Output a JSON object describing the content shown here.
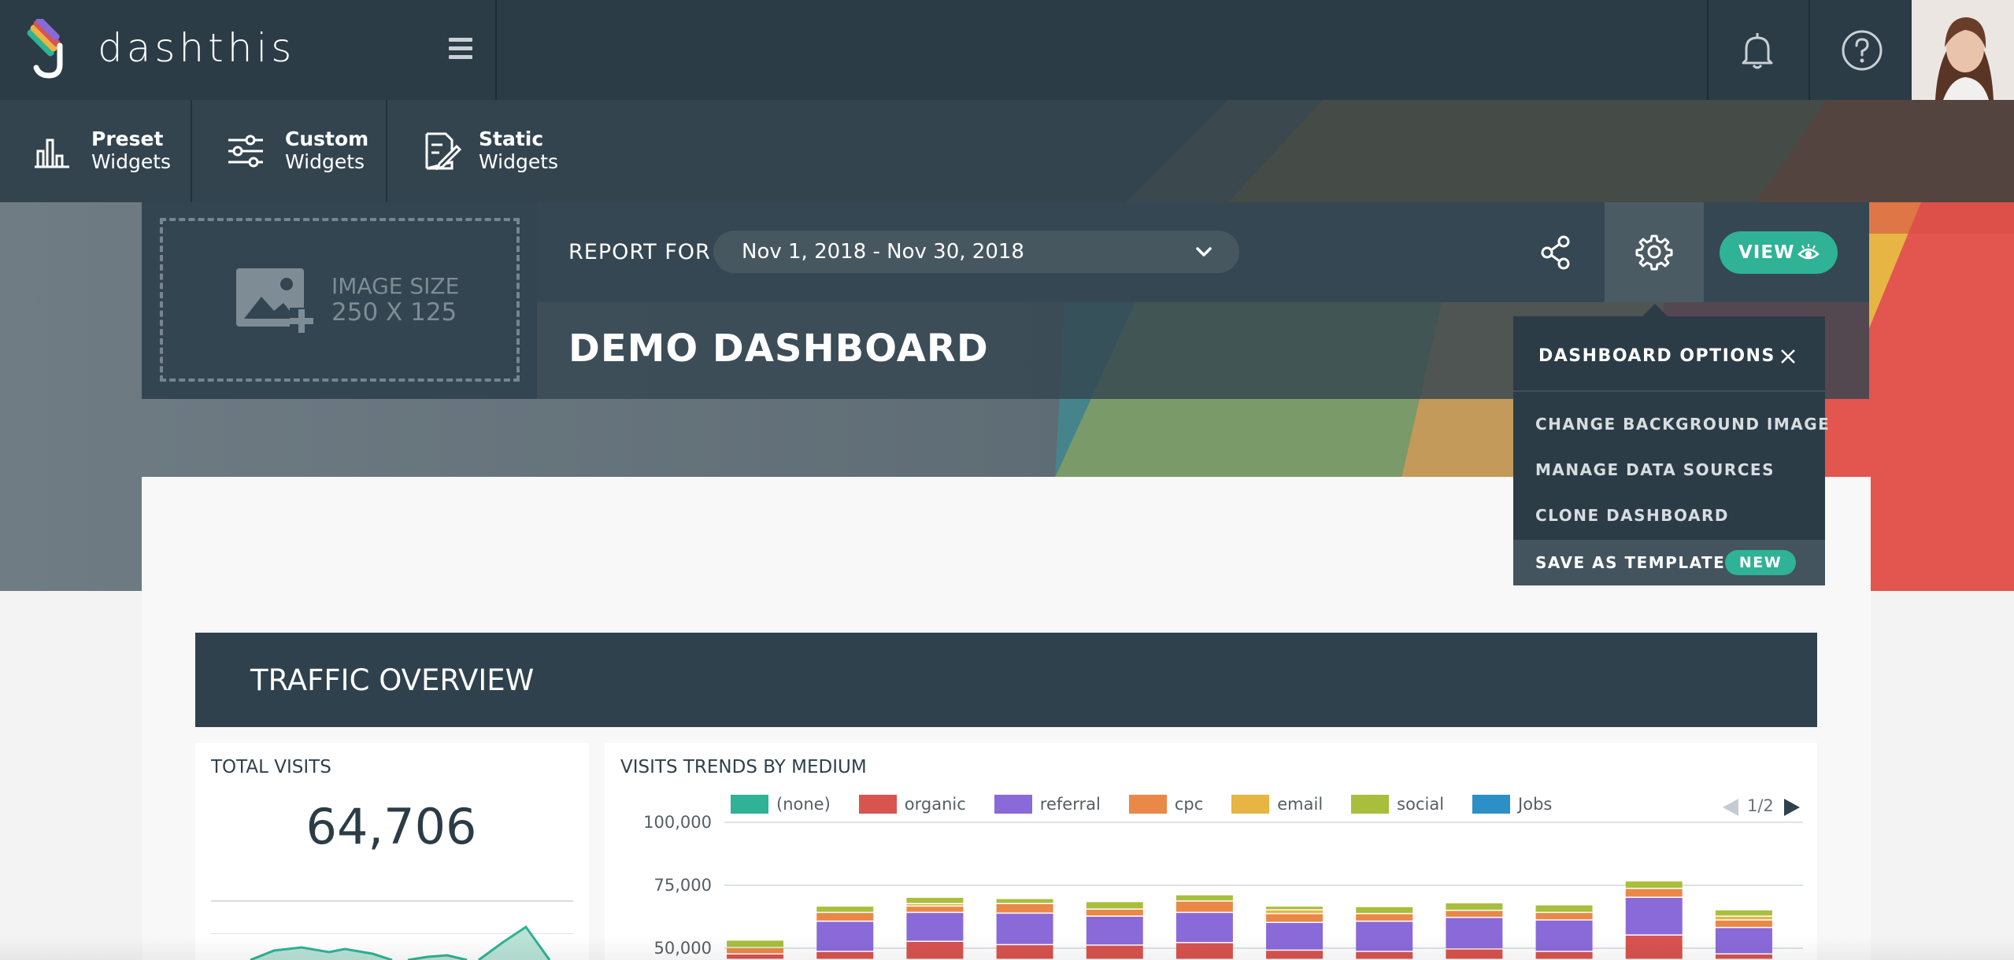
{
  "app": {
    "brand": "dashthis"
  },
  "widget_tabs": [
    {
      "line1": "Preset",
      "line2": "Widgets",
      "icon": "bar-chart-icon"
    },
    {
      "line1": "Custom",
      "line2": "Widgets",
      "icon": "sliders-icon"
    },
    {
      "line1": "Static",
      "line2": "Widgets",
      "icon": "edit-note-icon"
    }
  ],
  "header": {
    "image_placeholder": {
      "line1": "IMAGE SIZE",
      "line2": "250 X 125"
    },
    "report_label": "REPORT FOR",
    "date_range": "Nov 1, 2018 - Nov 30, 2018",
    "view_label": "VIEW",
    "dashboard_title": "DEMO DASHBOARD"
  },
  "dashboard_options": {
    "title": "DASHBOARD OPTIONS",
    "items": [
      "CHANGE BACKGROUND IMAGE",
      "MANAGE DATA SOURCES",
      "CLONE DASHBOARD",
      "SAVE AS TEMPLATE"
    ],
    "new_badge": "NEW"
  },
  "section": {
    "title": "TRAFFIC OVERVIEW"
  },
  "total_visits": {
    "title": "TOTAL VISITS",
    "value": "64,706"
  },
  "visits_trends": {
    "title": "VISITS TRENDS BY MEDIUM",
    "pager": "1/2"
  },
  "colors": {
    "accent": "#2fb295",
    "topbar": "#2b3c47",
    "none": "#2fb295",
    "organic": "#d9534f",
    "referral": "#8a6ad8",
    "cpc": "#ea8848",
    "email": "#e7b544",
    "social": "#a9be3c",
    "jobs": "#2d8fc8"
  },
  "chart_data": {
    "type": "bar",
    "stacked": true,
    "title": "VISITS TRENDS BY MEDIUM",
    "legend": [
      "(none)",
      "organic",
      "referral",
      "cpc",
      "email",
      "social",
      "Jobs"
    ],
    "legend_placement": "top",
    "y_ticks": [
      "100,000",
      "75,000",
      "50,000"
    ],
    "ylim": [
      50000,
      100000
    ],
    "grid": true,
    "series": [
      {
        "name": "(none)",
        "values": [
          0,
          0,
          0,
          0,
          0,
          0,
          0,
          0,
          0,
          0,
          0,
          0
        ]
      },
      {
        "name": "organic",
        "values": [
          47500,
          48500,
          52500,
          51200,
          51000,
          52000,
          49000,
          48500,
          49500,
          48500,
          55000,
          47500
        ]
      },
      {
        "name": "referral",
        "values": [
          0,
          12000,
          11500,
          12500,
          11500,
          12000,
          11000,
          12000,
          12500,
          12500,
          15000,
          10500
        ]
      },
      {
        "name": "cpc",
        "values": [
          2500,
          3500,
          2500,
          3800,
          2800,
          4500,
          3500,
          3000,
          2800,
          3000,
          3500,
          3000
        ]
      },
      {
        "name": "email",
        "values": [
          0,
          0,
          1000,
          0,
          0,
          0,
          1500,
          0,
          0,
          0,
          0,
          1500
        ]
      },
      {
        "name": "social",
        "values": [
          3000,
          2500,
          2500,
          2000,
          3000,
          2500,
          1500,
          2800,
          3000,
          3000,
          3000,
          2500
        ]
      },
      {
        "name": "Jobs",
        "values": [
          0,
          0,
          0,
          0,
          0,
          0,
          0,
          0,
          0,
          0,
          0,
          0
        ]
      }
    ]
  }
}
